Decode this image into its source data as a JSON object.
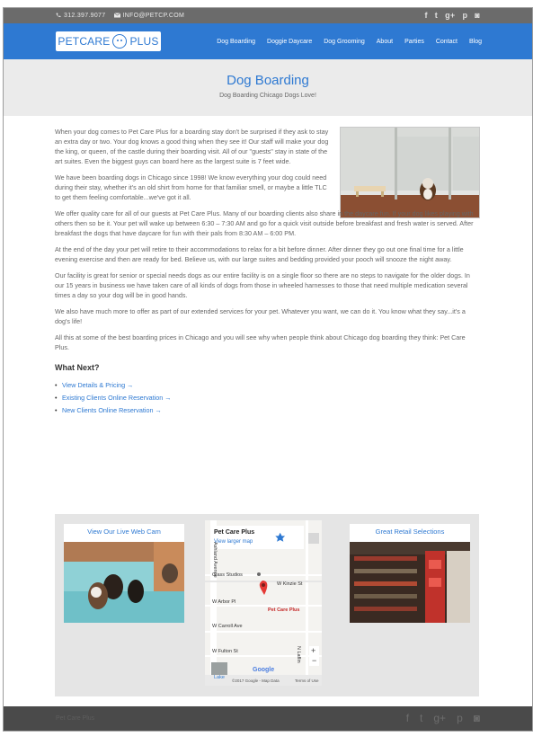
{
  "topbar": {
    "phone": "312.397.9077",
    "email": "INFO@PETCP.COM",
    "socials": [
      {
        "icon": "facebook-icon",
        "glyph": "f"
      },
      {
        "icon": "twitter-icon",
        "glyph": "t"
      },
      {
        "icon": "google-plus-icon",
        "glyph": "g+"
      },
      {
        "icon": "pinterest-icon",
        "glyph": "p"
      },
      {
        "icon": "instagram-icon",
        "glyph": "◙"
      }
    ]
  },
  "header": {
    "logo_left": "PETCARE",
    "logo_right": "PLUS",
    "nav": [
      "Dog Boarding",
      "Doggie Daycare",
      "Dog Grooming",
      "About",
      "Parties",
      "Contact",
      "Blog"
    ]
  },
  "title": {
    "heading": "Dog Boarding",
    "subheading": "Dog Boarding Chicago Dogs Love!"
  },
  "content": {
    "p1": "When your dog comes to Pet Care Plus for a boarding stay don't be surprised if they ask to stay an extra day or two. Your dog knows a good thing when they see it! Our staff will make your dog the king, or queen, of the castle during their boarding visit. All of our \"guests\" stay in state of the art suites. Even the biggest guys can board here as the largest suite is 7 feet wide.",
    "p2": "We have been boarding dogs in Chicago since 1998! We know everything your dog could need during their stay, whether it's an old shirt from home for that familiar smell, or maybe a little TLC to get them feeling comfortable...we've got it all.",
    "p3": "We offer quality care for all of our guests at Pet Care Plus. Many of our boarding clients also share in the daycare fun. If your dog likes playing with others then so be it. Your pet will wake up between 6:30 – 7:30 AM and go for a quick visit outside before breakfast and fresh water is served. After breakfast the dogs that have daycare for fun with their pals from 8:30 AM – 6:00 PM.",
    "p4": "At the end of the day your pet will retire to their accommodations to relax for a bit before dinner. After dinner they go out one final time for a little evening exercise and then are ready for bed. Believe us, with our large suites and bedding provided your pooch will snooze the night away.",
    "p5": "Our facility is great for senior or special needs dogs as our entire facility is on a single floor so there are no steps to navigate for the older dogs. In our 15 years in business we have taken care of all kinds of dogs from those in wheeled harnesses to those that need multiple medication several times a day so your dog will be in good hands.",
    "p6": "We also have much more to offer as part of our extended services for your pet. Whatever you want, we can do it. You know what they say...it's a dog's life!",
    "p7": "All this at some of the best boarding prices in Chicago and you will see why when people think about Chicago dog boarding they think: Pet Care Plus.",
    "what_next": "What Next?",
    "links": [
      "View Details & Pricing →",
      "Existing Clients Online Reservation →",
      "New Clients Online Reservation →"
    ]
  },
  "widgets": {
    "webcam_title": "View Our Live Web Cam",
    "retail_title": "Great Retail Selections",
    "map": {
      "place": "Pet Care Plus",
      "larger": "View larger map",
      "labels": [
        "Glass Studios",
        "W Kinzie St",
        "W Arbor Pl",
        "W Carroll Ave",
        "W Fulton St",
        "Ashland Avenue",
        "N Laflin",
        "Lake",
        "Google"
      ],
      "marker_label": "Pet Care Plus",
      "copyright": "©2017 Google - Map Data",
      "terms": "Terms of Use",
      "zoom_in": "+",
      "zoom_out": "−"
    }
  },
  "footer": {
    "credit": "Pet Care Plus",
    "socials": [
      {
        "icon": "facebook-icon",
        "glyph": "f"
      },
      {
        "icon": "twitter-icon",
        "glyph": "t"
      },
      {
        "icon": "google-plus-icon",
        "glyph": "g+"
      },
      {
        "icon": "pinterest-icon",
        "glyph": "p"
      },
      {
        "icon": "instagram-icon",
        "glyph": "◙"
      }
    ]
  },
  "colors": {
    "brand": "#2e79d2",
    "topbar": "#6b6b6b",
    "footer": "#4a4a4a"
  }
}
